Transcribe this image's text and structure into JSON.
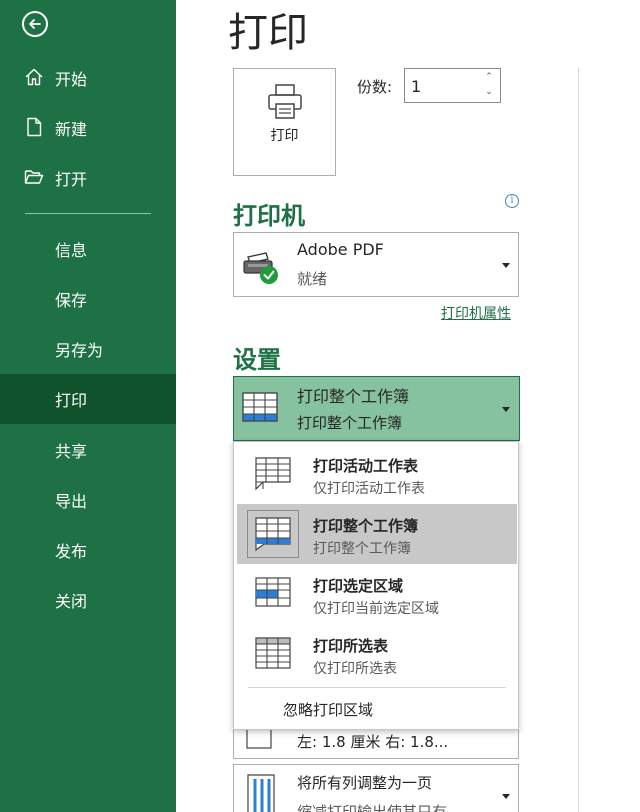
{
  "sidebar": {
    "back": {
      "icon": "back-arrow-icon"
    },
    "items": [
      {
        "label": "开始",
        "icon": "home-icon"
      },
      {
        "label": "新建",
        "icon": "new-document-icon"
      },
      {
        "label": "打开",
        "icon": "open-folder-icon"
      },
      {
        "label": "信息"
      },
      {
        "label": "保存"
      },
      {
        "label": "另存为"
      },
      {
        "label": "打印",
        "active": true
      },
      {
        "label": "共享"
      },
      {
        "label": "导出"
      },
      {
        "label": "发布"
      },
      {
        "label": "关闭"
      }
    ]
  },
  "main": {
    "title": "打印",
    "print_button": {
      "label": "打印",
      "icon": "printer-icon"
    },
    "copies": {
      "label": "份数:",
      "value": "1"
    },
    "printer_section": {
      "heading": "打印机",
      "info_icon": "info-icon",
      "selected": {
        "name": "Adobe PDF",
        "status": "就绪",
        "icon": "printer-ready-icon"
      },
      "properties_link": "打印机属性"
    },
    "settings_section": {
      "heading": "设置",
      "scope_select": {
        "main": "打印整个工作簿",
        "sub": "打印整个工作簿"
      },
      "dropdown": {
        "options": [
          {
            "main": "打印活动工作表",
            "sub": "仅打印活动工作表"
          },
          {
            "main": "打印整个工作簿",
            "sub": "打印整个工作簿",
            "selected": true
          },
          {
            "main": "打印选定区域",
            "sub": "仅打印当前选定区域"
          },
          {
            "main": "打印所选表",
            "sub": "仅打印所选表"
          }
        ],
        "ignore_print_area": "忽略打印区域"
      },
      "margins_row": {
        "text": "左:  1.8 厘米     右:  1.8..."
      },
      "scaling_row": {
        "main": "将所有列调整为一页",
        "sub": "缩减打印输出使其只有"
      }
    }
  },
  "colors": {
    "sidebar_bg": "#1e7145",
    "sidebar_active": "#0f522c",
    "accent": "#1e7145",
    "selected_select": "#86c29f"
  }
}
